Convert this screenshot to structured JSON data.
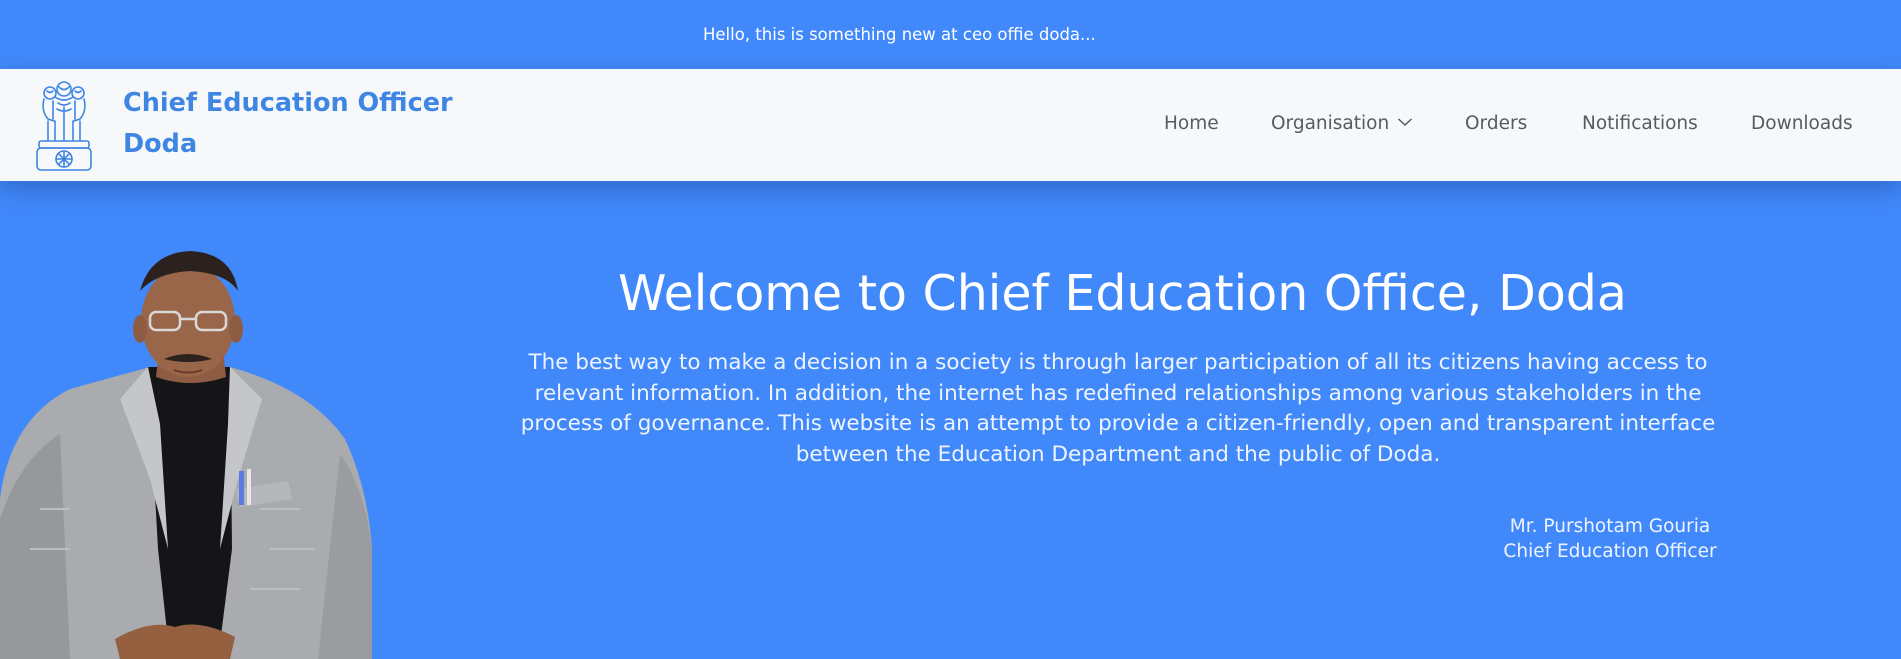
{
  "announcement": {
    "text": "Hello, this is something new at ceo offie doda..."
  },
  "header": {
    "brand_line1": "Chief Education Officer",
    "brand_line2": "Doda",
    "emblem_icon": "national-emblem-icon"
  },
  "nav": {
    "items": [
      {
        "label": "Home"
      },
      {
        "label": "Organisation",
        "has_dropdown": true
      },
      {
        "label": "Orders"
      },
      {
        "label": "Notifications"
      },
      {
        "label": "Downloads"
      }
    ]
  },
  "hero": {
    "title": "Welcome to Chief Education Office, Doda",
    "description": "The best way to make a decision in a society is through larger participation of all its citizens having access to relevant information. In addition, the internet has redefined relationships among various stakeholders in the process of governance. This website is an attempt to provide a citizen-friendly, open and transparent interface between the Education Department and the public of Doda.",
    "signature_name": "Mr. Purshotam Gouria",
    "signature_role": "Chief Education Officer"
  },
  "colors": {
    "brand_blue": "#4189fb",
    "header_bg": "#f6f8fa",
    "brand_text": "#3f86e4",
    "nav_text": "#545b63"
  }
}
